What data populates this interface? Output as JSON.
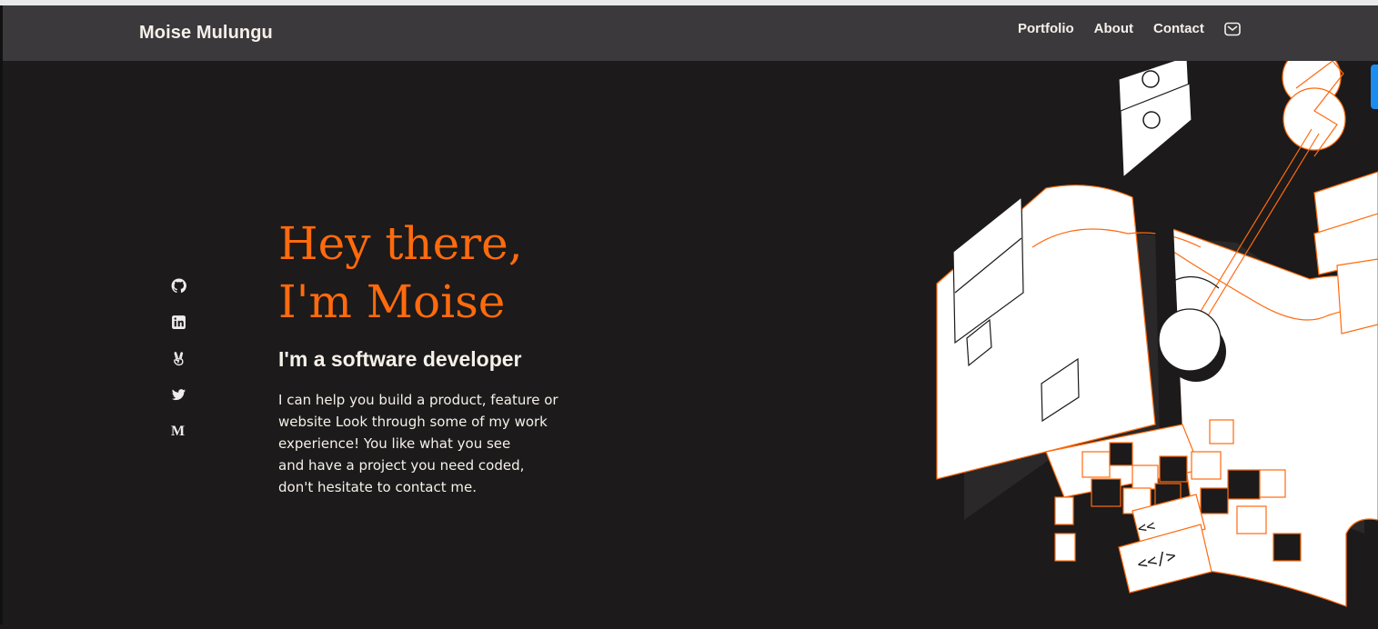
{
  "header": {
    "brand": "Moise Mulungu",
    "nav": [
      {
        "label": "Portfolio"
      },
      {
        "label": "About"
      },
      {
        "label": "Contact"
      }
    ],
    "mail_icon": "envelope-icon"
  },
  "social": [
    {
      "icon": "github-icon"
    },
    {
      "icon": "linkedin-icon"
    },
    {
      "icon": "angellist-icon"
    },
    {
      "icon": "twitter-icon"
    },
    {
      "icon": "medium-icon",
      "glyph": "M"
    }
  ],
  "hero": {
    "title_line1": "Hey there,",
    "title_line2": "I'm Moise",
    "subtitle": "I'm a software developer",
    "desc_line1": "I can help you build a product, feature or",
    "desc_line2": "website Look through some of my work",
    "desc_line3": "experience! You like what you see",
    "desc_line4": "and have a project you need coded,",
    "desc_line5": "don't hesitate to contact me."
  },
  "illustration": {
    "code_label_1": "<<",
    "code_label_2": "<</>"
  },
  "colors": {
    "background": "#1c1a1a",
    "navbar": "#3b393c",
    "accent": "#ff6a0d",
    "text": "#f6f0ea"
  }
}
